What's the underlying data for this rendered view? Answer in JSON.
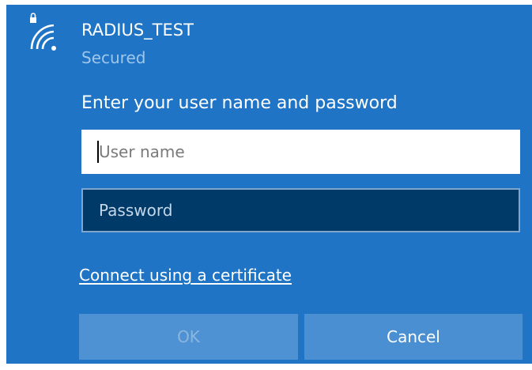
{
  "network": {
    "name": "RADIUS_TEST",
    "status": "Secured",
    "icon": "wifi-secured-icon"
  },
  "prompt": "Enter your user name and password",
  "fields": {
    "username": {
      "placeholder": "User name",
      "value": ""
    },
    "password": {
      "placeholder": "Password",
      "value": ""
    }
  },
  "certificate_link": "Connect using a certificate",
  "buttons": {
    "ok_label": "OK",
    "cancel_label": "Cancel"
  },
  "colors": {
    "panel_bg": "#1f74c6",
    "password_bg": "#003a68",
    "button_bg": "#4a8fd2",
    "disabled_text": "#8ab6df"
  }
}
